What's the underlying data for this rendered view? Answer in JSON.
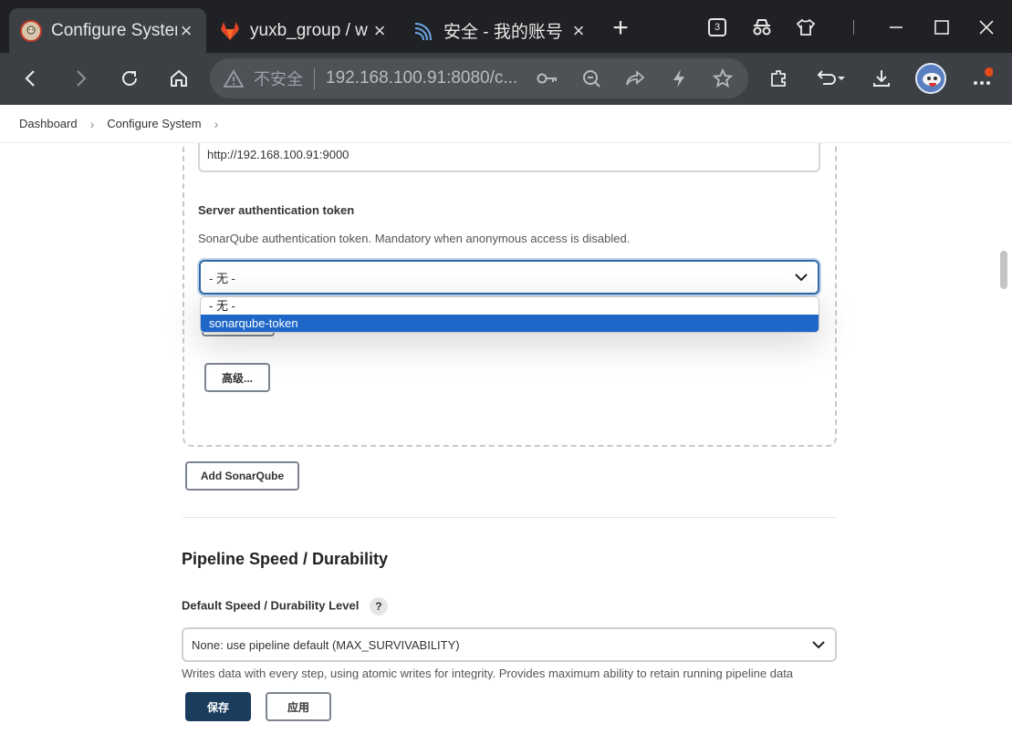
{
  "browser": {
    "tabs": [
      {
        "title": "Configure System",
        "favicon": "jenkins-icon",
        "active": true
      },
      {
        "title": "yuxb_group / w",
        "favicon": "gitlab-icon",
        "active": false
      },
      {
        "title": "安全 - 我的账号",
        "favicon": "security-swirl-icon",
        "active": false
      }
    ],
    "tab_count_badge": "3",
    "address": {
      "warning": "不安全",
      "url": "192.168.100.91:8080/c..."
    }
  },
  "breadcrumb": {
    "items": [
      "Dashboard",
      "Configure System"
    ]
  },
  "sonarqube": {
    "server_url_value": "http://192.168.100.91:9000",
    "token_label": "Server authentication token",
    "token_help": "SonarQube authentication token. Mandatory when anonymous access is disabled.",
    "token_selected": "- 无 -",
    "token_options": [
      "- 无 -",
      "sonarqube-token"
    ],
    "advanced_button": "高级...",
    "add_button": "Add SonarQube"
  },
  "pipeline": {
    "section_title": "Pipeline Speed / Durability",
    "level_label": "Default Speed / Durability Level",
    "help_mark": "?",
    "level_selected": "None: use pipeline default (MAX_SURVIVABILITY)",
    "level_help": "Writes data with every step, using atomic writes for integrity.  Provides maximum ability to retain running pipeline data"
  },
  "footer": {
    "save_button": "保存",
    "apply_button": "应用"
  },
  "colors": {
    "tabstrip_bg": "#202124",
    "toolbar_bg": "#3c3f44",
    "select_focus": "#2f6aa7",
    "option_highlight": "#1e67c8",
    "primary_button": "#1a3d5e"
  }
}
